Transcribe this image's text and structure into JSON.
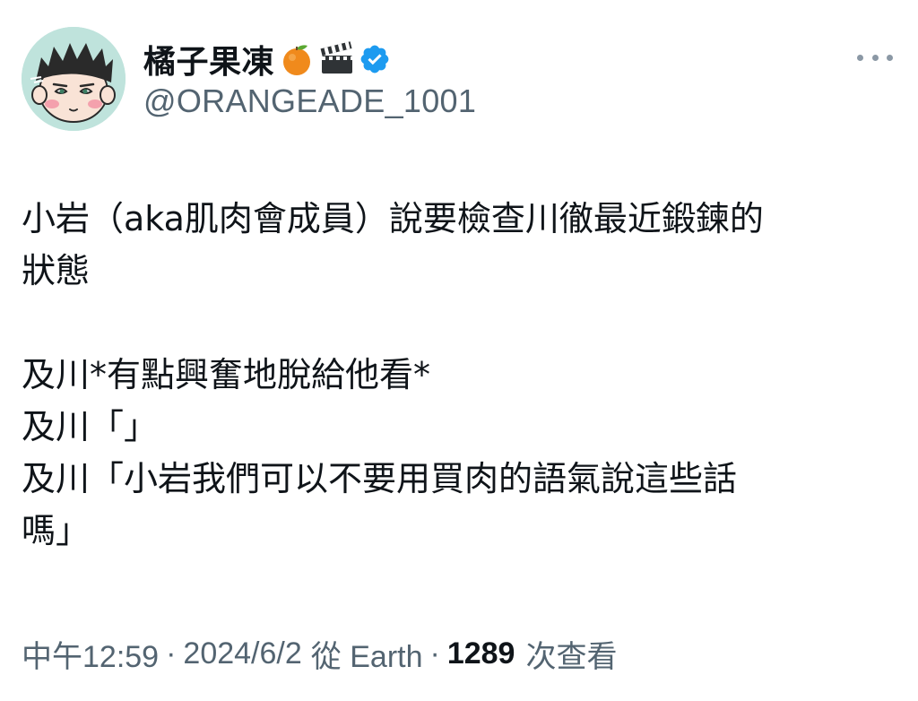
{
  "author": {
    "display_name": "橘子果凍",
    "handle": "@ORANGEADE_1001",
    "badges": [
      "tangerine-emoji",
      "clapper-board-emoji",
      "verified-badge-icon"
    ]
  },
  "tweet": {
    "lines": [
      "小岩（aka肌肉會成員）說要檢查川徹最近鍛鍊的",
      "狀態",
      "",
      "及川*有點興奮地脫給他看*",
      "及川「」",
      "及川「小岩我們可以不要用買肉的語氣說這些話",
      "嗎」"
    ]
  },
  "meta": {
    "time": "中午12:59",
    "separator": "·",
    "date": "2024/6/2",
    "source": "從 Earth",
    "views_count": "1289",
    "views_label": "次查看"
  },
  "colors": {
    "text_primary": "#0f1419",
    "text_secondary": "#536471",
    "verified_blue": "#1d9bf0",
    "avatar_bg": "#bfe3dc"
  },
  "icons": {
    "more": "more-horizontal-icon"
  }
}
